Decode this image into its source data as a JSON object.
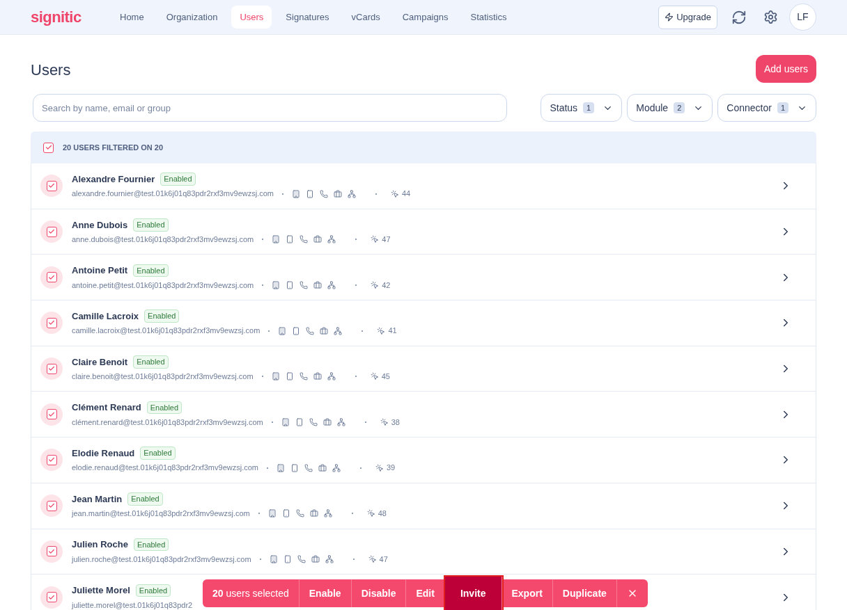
{
  "header": {
    "logo": "signitic",
    "nav": [
      {
        "label": "Home",
        "selected": false
      },
      {
        "label": "Organization",
        "selected": false
      },
      {
        "label": "Users",
        "selected": true
      },
      {
        "label": "Signatures",
        "selected": false
      },
      {
        "label": "vCards",
        "selected": false
      },
      {
        "label": "Campaigns",
        "selected": false
      },
      {
        "label": "Statistics",
        "selected": false
      }
    ],
    "upgrade": "Upgrade",
    "avatar": "LF"
  },
  "page": {
    "title": "Users",
    "add_button": "Add users"
  },
  "search": {
    "placeholder": "Search by name, email or group"
  },
  "filters": [
    {
      "label": "Status",
      "count": "1"
    },
    {
      "label": "Module",
      "count": "2"
    },
    {
      "label": "Connector",
      "count": "1"
    }
  ],
  "summary": {
    "checked": true,
    "text": "20 USERS FILTERED ON 20"
  },
  "users": [
    {
      "name": "Alexandre Fournier",
      "status": "Enabled",
      "email": "alexandre.fournier@test.01k6j01q83pdr2rxf3mv9ewzsj.com",
      "clicks": "44",
      "checked": true
    },
    {
      "name": "Anne Dubois",
      "status": "Enabled",
      "email": "anne.dubois@test.01k6j01q83pdr2rxf3mv9ewzsj.com",
      "clicks": "47",
      "checked": true
    },
    {
      "name": "Antoine Petit",
      "status": "Enabled",
      "email": "antoine.petit@test.01k6j01q83pdr2rxf3mv9ewzsj.com",
      "clicks": "42",
      "checked": true
    },
    {
      "name": "Camille Lacroix",
      "status": "Enabled",
      "email": "camille.lacroix@test.01k6j01q83pdr2rxf3mv9ewzsj.com",
      "clicks": "41",
      "checked": true
    },
    {
      "name": "Claire Benoit",
      "status": "Enabled",
      "email": "claire.benoit@test.01k6j01q83pdr2rxf3mv9ewzsj.com",
      "clicks": "45",
      "checked": true
    },
    {
      "name": "Clément Renard",
      "status": "Enabled",
      "email": "clément.renard@test.01k6j01q83pdr2rxf3mv9ewzsj.com",
      "clicks": "38",
      "checked": true
    },
    {
      "name": "Elodie Renaud",
      "status": "Enabled",
      "email": "elodie.renaud@test.01k6j01q83pdr2rxf3mv9ewzsj.com",
      "clicks": "39",
      "checked": true
    },
    {
      "name": "Jean Martin",
      "status": "Enabled",
      "email": "jean.martin@test.01k6j01q83pdr2rxf3mv9ewzsj.com",
      "clicks": "48",
      "checked": true
    },
    {
      "name": "Julien Roche",
      "status": "Enabled",
      "email": "julien.roche@test.01k6j01q83pdr2rxf3mv9ewzsj.com",
      "clicks": "47",
      "checked": true
    },
    {
      "name": "Juliette Morel",
      "status": "Enabled",
      "email": "juliette.morel@test.01k6j01q83pdr2",
      "checked": true
    }
  ],
  "action_bar": {
    "count": "20",
    "label": "users selected",
    "actions": [
      {
        "label": "Enable",
        "selected": false
      },
      {
        "label": "Disable",
        "selected": false
      },
      {
        "label": "Edit",
        "selected": false
      },
      {
        "label": "Invite",
        "selected": true
      },
      {
        "label": "Export",
        "selected": false
      },
      {
        "label": "Duplicate",
        "selected": false
      }
    ]
  }
}
